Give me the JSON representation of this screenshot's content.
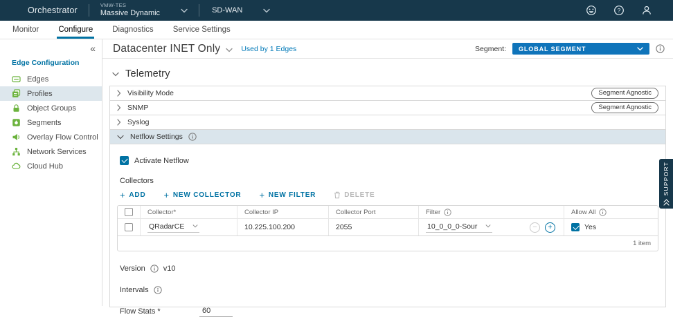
{
  "colors": {
    "header_bg": "#17384B",
    "accent_blue": "#0072A3",
    "segment_button_blue": "#0F74BA",
    "sidebar_icon_green": "#6CB33E",
    "selected_row_bg": "#DDE7ED",
    "panel_header_bg": "#DAE5EC"
  },
  "topbar": {
    "product": "Orchestrator",
    "org_label": "VMW-TES",
    "org_name": "Massive Dynamic",
    "service_name": "SD-WAN"
  },
  "nav": {
    "tabs": [
      "Monitor",
      "Configure",
      "Diagnostics",
      "Service Settings"
    ],
    "active_tab": "Configure"
  },
  "sidebar": {
    "title": "Edge Configuration",
    "items": [
      {
        "label": "Edges",
        "icon": "edges-icon"
      },
      {
        "label": "Profiles",
        "icon": "profiles-icon",
        "selected": true
      },
      {
        "label": "Object Groups",
        "icon": "object-groups-icon"
      },
      {
        "label": "Segments",
        "icon": "segments-icon"
      },
      {
        "label": "Overlay Flow Control",
        "icon": "overlay-flow-control-icon"
      },
      {
        "label": "Network Services",
        "icon": "network-services-icon"
      },
      {
        "label": "Cloud Hub",
        "icon": "cloud-hub-icon"
      }
    ]
  },
  "profile_header": {
    "name": "Datacenter INET Only",
    "used_by": "Used by 1 Edges",
    "segment_label": "Segment:",
    "segment_value": "GLOBAL SEGMENT"
  },
  "telemetry": {
    "title": "Telemetry",
    "sections": [
      {
        "label": "Visibility Mode",
        "badge": "Segment Agnostic",
        "expanded": false
      },
      {
        "label": "SNMP",
        "badge": "Segment Agnostic",
        "expanded": false
      },
      {
        "label": "Syslog",
        "badge": "",
        "expanded": false
      },
      {
        "label": "Netflow Settings",
        "badge": "",
        "expanded": true
      }
    ]
  },
  "netflow": {
    "activate_label": "Activate Netflow",
    "activate_checked": true,
    "collectors_label": "Collectors",
    "toolbar": {
      "add": "ADD",
      "new_collector": "NEW COLLECTOR",
      "new_filter": "NEW FILTER",
      "delete": "DELETE"
    },
    "table": {
      "columns": [
        "Collector*",
        "Collector IP",
        "Collector Port",
        "Filter",
        "Allow All"
      ],
      "row": {
        "collector": "QRadarCE",
        "ip": "10.225.100.200",
        "port": "2055",
        "filter": "10_0_0_0-Sour",
        "allow_all": "Yes",
        "allow_all_checked": true
      },
      "footer": "1 item"
    },
    "version_label": "Version",
    "version_value": "v10",
    "intervals_label": "Intervals",
    "flow_stats_label": "Flow Stats *",
    "flow_stats_value": "60"
  },
  "support_tab": {
    "label": "SUPPORT"
  }
}
